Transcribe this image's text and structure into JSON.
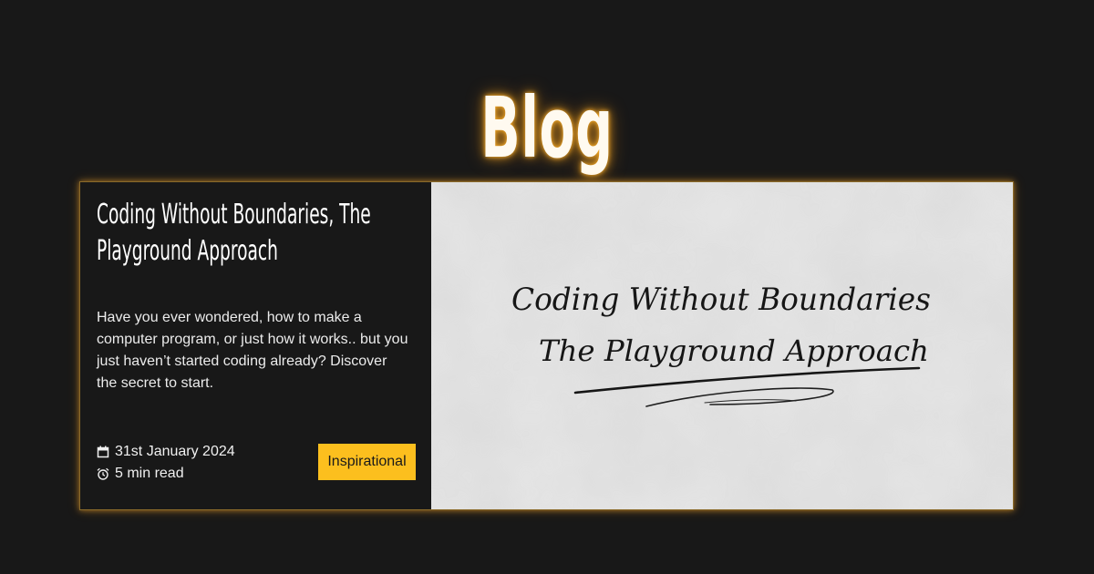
{
  "page": {
    "title": "Blog"
  },
  "post": {
    "title": "Coding Without Boundaries, The Playground Approach",
    "excerpt": "Have you ever wondered, how to make a computer program, or just how it works.. but you just haven’t started coding already? Discover the secret to start.",
    "date": "31st January 2024",
    "read_time": "5 min read",
    "tag": "Inspirational",
    "image": {
      "line1": "Coding Without Boundaries",
      "line2": "The Playground Approach"
    },
    "icons": {
      "date": "calendar-icon",
      "read_time": "alarm-clock-icon"
    }
  },
  "colors": {
    "background": "#181818",
    "accent": "#fcbf1e",
    "glow": "#ffb028"
  }
}
